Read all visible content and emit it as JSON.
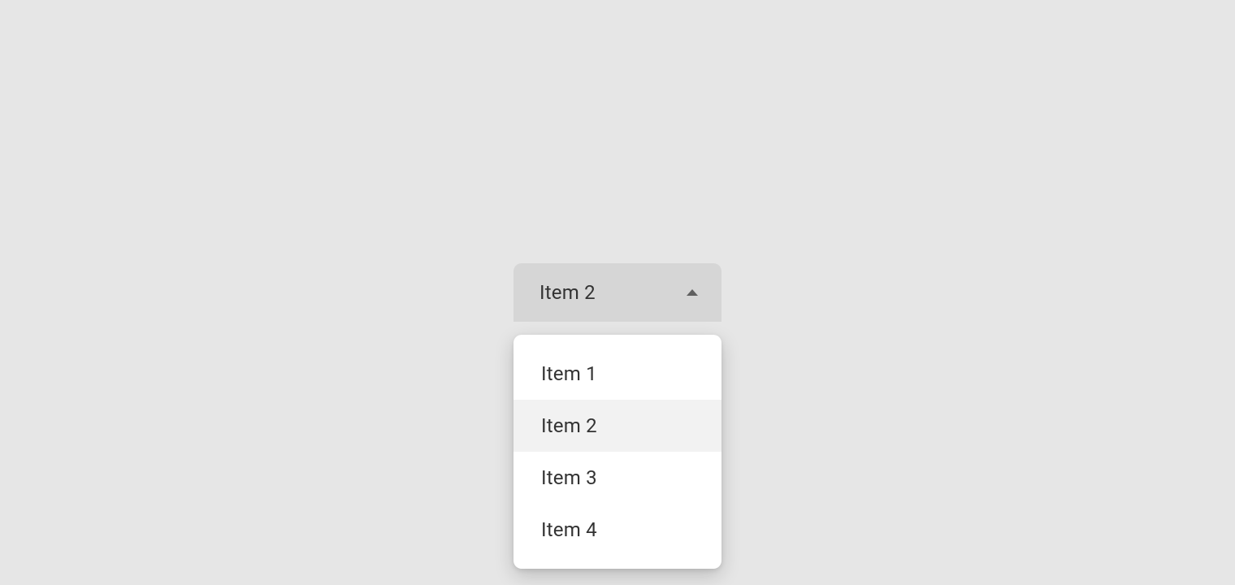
{
  "dropdown": {
    "selected": "Item 2",
    "options": [
      {
        "label": "Item 1"
      },
      {
        "label": "Item 2"
      },
      {
        "label": "Item 3"
      },
      {
        "label": "Item 4"
      }
    ],
    "selected_index": 1
  }
}
